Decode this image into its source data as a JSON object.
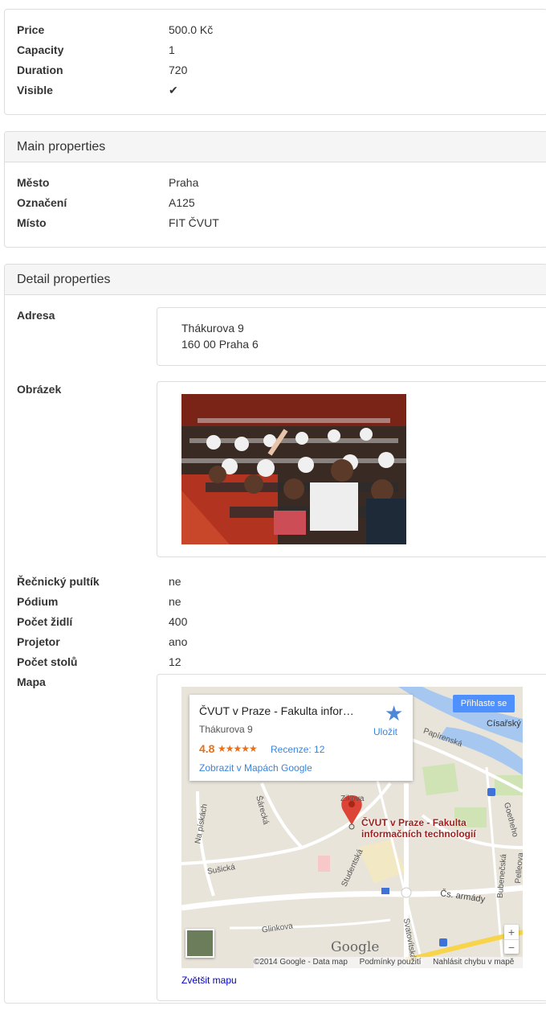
{
  "panel1": {
    "rows": [
      {
        "label": "Price",
        "value": "500.0 Kč"
      },
      {
        "label": "Capacity",
        "value": "1"
      },
      {
        "label": "Duration",
        "value": "720"
      },
      {
        "label": "Visible",
        "value": "✔"
      }
    ]
  },
  "panel2": {
    "heading": "Main properties",
    "rows": [
      {
        "label": "Město",
        "value": "Praha"
      },
      {
        "label": "Označení",
        "value": "A125"
      },
      {
        "label": "Místo",
        "value": "FIT ČVUT"
      }
    ]
  },
  "panel3": {
    "heading": "Detail properties",
    "address": {
      "label": "Adresa",
      "line1": "Thákurova 9",
      "line2": "160 00 Praha 6"
    },
    "image": {
      "label": "Obrázek"
    },
    "rows": [
      {
        "label": "Řečnický pultík",
        "value": "ne"
      },
      {
        "label": "Pódium",
        "value": "ne"
      },
      {
        "label": "Počet židlí",
        "value": "400"
      },
      {
        "label": "Projetor",
        "value": "ano"
      },
      {
        "label": "Počet stolů",
        "value": "12"
      }
    ],
    "map": {
      "label": "Mapa",
      "info_title": "ČVUT v Praze - Fakulta informačních technologií",
      "info_address": "Thákurova 9",
      "rating": "4.8",
      "stars": "★★★★★",
      "reviews": "Recenze: 12",
      "view_link": "Zobrazit v Mapách Google",
      "save": "Uložit",
      "sign_in": "Přihlaste se",
      "place_label_1": "ČVUT v Praze - Fakulta",
      "place_label_2": "informačních technologií",
      "street_labels": [
        "Císařský",
        "Papírenská",
        "Na pískách",
        "Šárecká",
        "Sušická",
        "Studentská",
        "Čs. armády",
        "Bubenečská",
        "Pelleova",
        "Svatovítská",
        "Glinkova",
        "Goetheho",
        "Zikova"
      ],
      "logo": "Google",
      "attribution": [
        "©2014 Google - Data map",
        "Podmínky použití",
        "Nahlásit chybu v mapě"
      ],
      "zoom_in": "+",
      "zoom_out": "−",
      "enlarge_link": "Zvětšit mapu"
    }
  },
  "colors": {
    "link": "#3a84df",
    "rating": "#e7711b",
    "signin": "#4d90fe",
    "pin": "#db4437"
  }
}
